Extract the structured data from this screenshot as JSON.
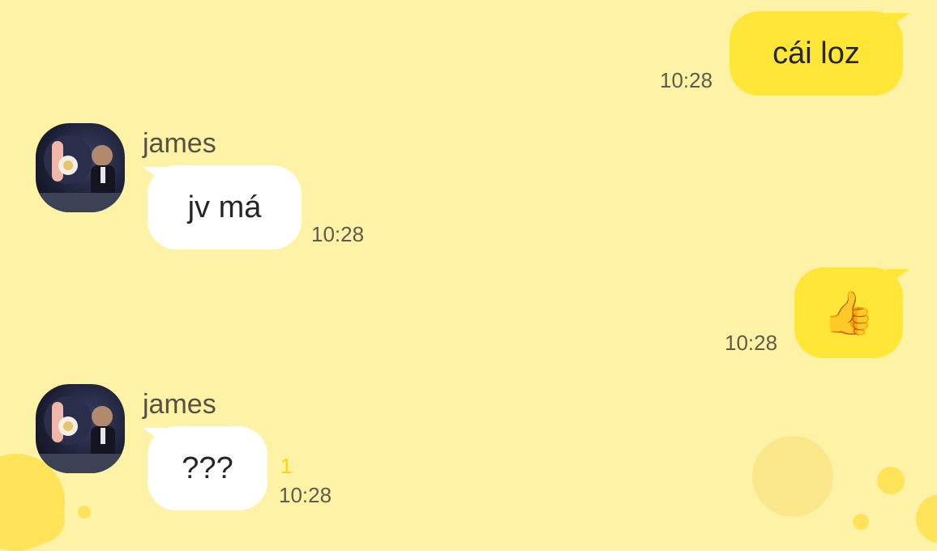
{
  "messages": [
    {
      "from": "me",
      "text": "cái loz",
      "time": "10:28"
    },
    {
      "from": "james",
      "sender": "james",
      "text": "jv má",
      "time": "10:28"
    },
    {
      "from": "me",
      "text": "👍",
      "time": "10:28"
    },
    {
      "from": "james",
      "sender": "james",
      "text": "???",
      "time": "10:28",
      "unread": "1"
    }
  ],
  "colors": {
    "background": "#fdf2a6",
    "my_bubble": "#ffe637",
    "their_bubble": "#ffffff",
    "unread_count": "#ffd400"
  },
  "icons": {
    "avatar": "profile-photo",
    "reaction": "thumbs-up-emoji"
  }
}
